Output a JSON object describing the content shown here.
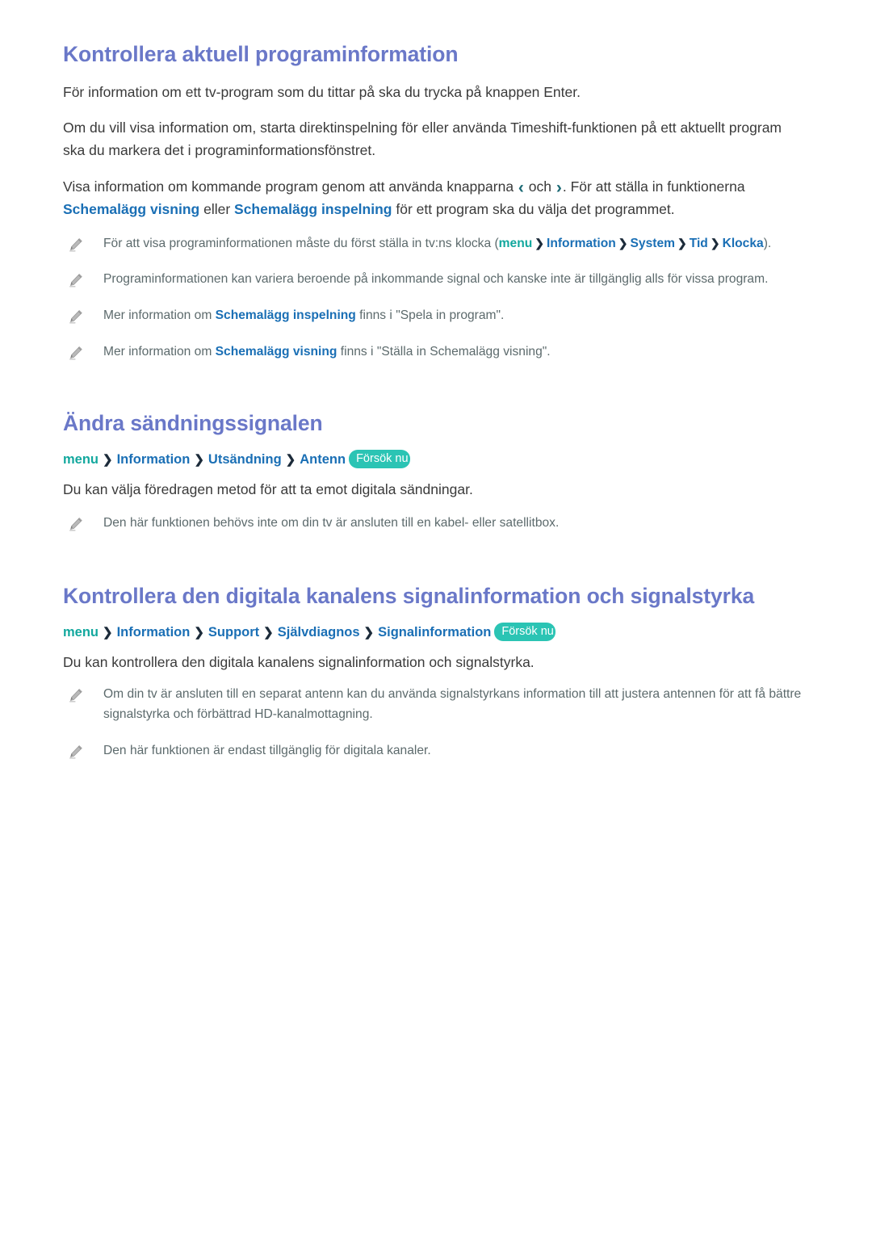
{
  "document": {
    "language": "sv",
    "colors": {
      "heading": "#6a78c8",
      "link_blue": "#1a6fb5",
      "menu_teal": "#13a89e",
      "badge_bg": "#2bc4b4",
      "body_text": "#3a3a3a",
      "note_text": "#5c6a6c"
    }
  },
  "sections": [
    {
      "title": "Kontrollera aktuell programinformation",
      "paragraphs": [
        "För information om ett tv-program som du tittar på ska du trycka på knappen Enter.",
        "Om du vill visa information om, starta direktinspelning för eller använda Timeshift-funktionen på ett aktuellt program ska du markera det i programinformationsfönstret."
      ],
      "paragraph3": {
        "part1": "Visa information om kommande program genom att använda knapparna ",
        "left_arrow": "‹",
        "between_arrows": " och ",
        "right_arrow": "›",
        "part2": ". För att ställa in funktionerna ",
        "term1": "Schemalägg visning",
        "mid": " eller ",
        "term2": "Schemalägg inspelning",
        "part3": " för ett program ska du välja det programmet."
      },
      "notes": [
        {
          "icon": "pencil-icon",
          "prefix": "För att visa programinformationen måste du först ställa in tv:ns klocka (",
          "path": [
            "menu",
            "Information",
            "System",
            "Tid",
            "Klocka"
          ],
          "suffix": ")."
        },
        {
          "icon": "pencil-icon",
          "text": "Programinformationen kan variera beroende på inkommande signal och kanske inte är tillgänglig alls för vissa program."
        },
        {
          "icon": "pencil-icon",
          "prefix": "Mer information om ",
          "term": "Schemalägg inspelning",
          "suffix": " finns i \"Spela in program\"."
        },
        {
          "icon": "pencil-icon",
          "prefix": "Mer information om ",
          "term": "Schemalägg visning",
          "suffix": " finns i \"Ställa in Schemalägg visning\"."
        }
      ]
    },
    {
      "title": "Ändra sändningssignalen",
      "nav_path": {
        "menu": "menu",
        "items": [
          "Information",
          "Utsändning",
          "Antenn"
        ],
        "separator": "›",
        "badge": "Försök nu"
      },
      "paragraphs": [
        "Du kan välja föredragen metod för att ta emot digitala sändningar."
      ],
      "notes": [
        {
          "icon": "pencil-icon",
          "text": "Den här funktionen behövs inte om din tv är ansluten till en kabel- eller satellitbox."
        }
      ]
    },
    {
      "title": "Kontrollera den digitala kanalens signalinformation och signalstyrka",
      "nav_path": {
        "menu": "menu",
        "items": [
          "Information",
          "Support",
          "Självdiagnos",
          "Signalinformation"
        ],
        "separator": "›",
        "badge": "Försök nu"
      },
      "paragraphs": [
        "Du kan kontrollera den digitala kanalens signalinformation och signalstyrka."
      ],
      "notes": [
        {
          "icon": "pencil-icon",
          "text": "Om din tv är ansluten till en separat antenn kan du använda signalstyrkans information till att justera antennen för att få bättre signalstyrka och förbättrad HD-kanalmottagning."
        },
        {
          "icon": "pencil-icon",
          "text": "Den här funktionen är endast tillgänglig för digitala kanaler."
        }
      ]
    }
  ]
}
